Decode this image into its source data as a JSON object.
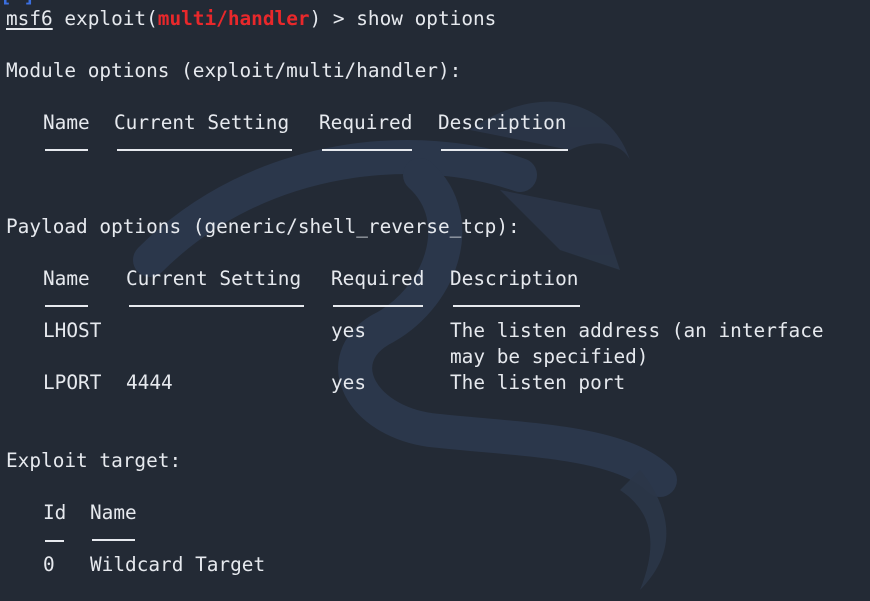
{
  "terminal": {
    "prompt": {
      "framework": "msf6",
      "pre_module": " exploit(",
      "module": "multi/handler",
      "post_module": ") > ",
      "command": "show options"
    },
    "module_options_title": "Module options (exploit/multi/handler):",
    "module_table": {
      "headers": [
        "Name",
        "Current Setting",
        "Required",
        "Description"
      ]
    },
    "payload_options_title": "Payload options (generic/shell_reverse_tcp):",
    "payload_table": {
      "headers": [
        "Name",
        "Current Setting",
        "Required",
        "Description"
      ],
      "rows": [
        {
          "name": "LHOST",
          "current_setting": "",
          "required": "yes",
          "description": "The listen address (an interface",
          "description_cont": "may be specified)"
        },
        {
          "name": "LPORT",
          "current_setting": "4444",
          "required": "yes",
          "description": "The listen port"
        }
      ]
    },
    "exploit_target_title": "Exploit target:",
    "target_table": {
      "headers": [
        "Id",
        "Name"
      ],
      "rows": [
        {
          "id": "0",
          "name": "Wildcard Target"
        }
      ]
    }
  },
  "colors": {
    "background": "#232a35",
    "text": "#e6e9ee",
    "module_highlight": "#e8282b"
  }
}
